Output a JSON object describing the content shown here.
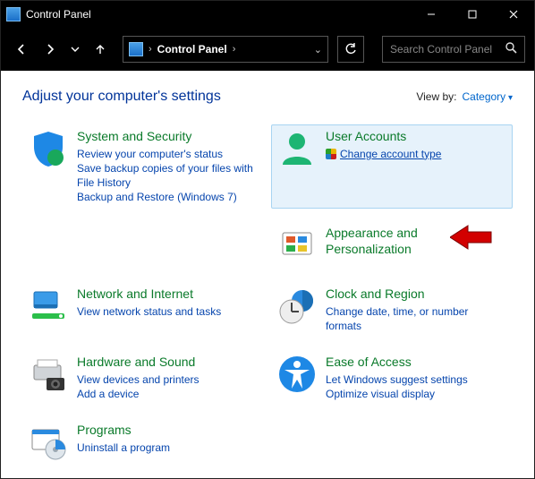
{
  "window": {
    "title": "Control Panel"
  },
  "address": {
    "location": "Control Panel"
  },
  "search": {
    "placeholder": "Search Control Panel"
  },
  "header": {
    "heading": "Adjust your computer's settings",
    "viewby_label": "View by:",
    "viewby_value": "Category"
  },
  "categories": {
    "system_security": {
      "title": "System and Security",
      "links": [
        "Review your computer's status",
        "Save backup copies of your files with File History",
        "Backup and Restore (Windows 7)"
      ]
    },
    "network_internet": {
      "title": "Network and Internet",
      "links": [
        "View network status and tasks"
      ]
    },
    "hardware_sound": {
      "title": "Hardware and Sound",
      "links": [
        "View devices and printers",
        "Add a device"
      ]
    },
    "programs": {
      "title": "Programs",
      "links": [
        "Uninstall a program"
      ]
    },
    "user_accounts": {
      "title": "User Accounts",
      "links": [
        "Change account type"
      ]
    },
    "appearance": {
      "title": "Appearance and Personalization",
      "links": []
    },
    "clock_region": {
      "title": "Clock and Region",
      "links": [
        "Change date, time, or number formats"
      ]
    },
    "ease_of_access": {
      "title": "Ease of Access",
      "links": [
        "Let Windows suggest settings",
        "Optimize visual display"
      ]
    }
  }
}
